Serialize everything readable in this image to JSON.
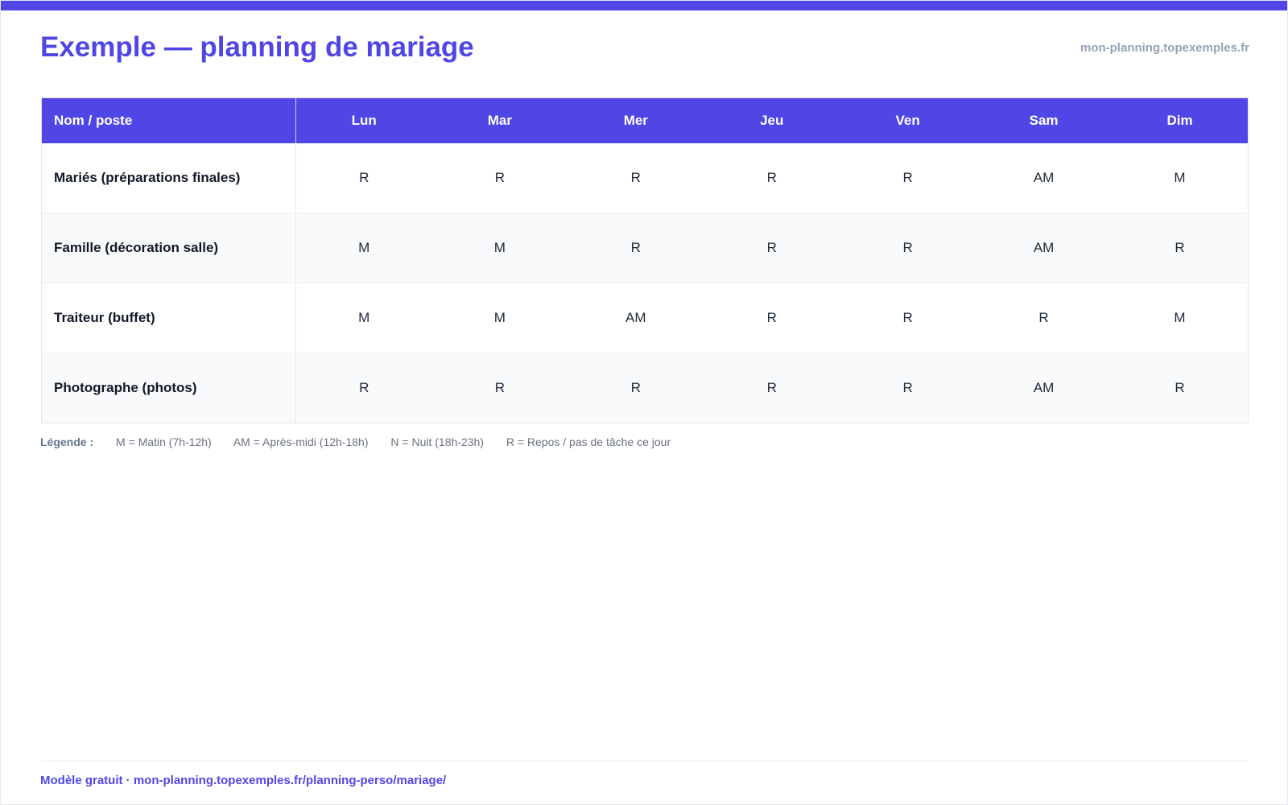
{
  "header": {
    "title": "Exemple — planning de mariage",
    "site": "mon-planning.topexemples.fr"
  },
  "table": {
    "columns": [
      "Nom / poste",
      "Lun",
      "Mar",
      "Mer",
      "Jeu",
      "Ven",
      "Sam",
      "Dim"
    ],
    "rows": [
      {
        "name": "Mariés (préparations finales)",
        "cells": [
          "R",
          "R",
          "R",
          "R",
          "R",
          "AM",
          "M"
        ]
      },
      {
        "name": "Famille (décoration salle)",
        "cells": [
          "M",
          "M",
          "R",
          "R",
          "R",
          "AM",
          "R"
        ]
      },
      {
        "name": "Traiteur (buffet)",
        "cells": [
          "M",
          "M",
          "AM",
          "R",
          "R",
          "R",
          "M"
        ]
      },
      {
        "name": "Photographe (photos)",
        "cells": [
          "R",
          "R",
          "R",
          "R",
          "R",
          "AM",
          "R"
        ]
      }
    ]
  },
  "legend": {
    "label": "Légende :",
    "items": [
      "M = Matin (7h-12h)",
      "AM = Après-midi (12h-18h)",
      "N = Nuit (18h-23h)",
      "R = Repos / pas de tâche ce jour"
    ]
  },
  "footer": {
    "text": "Modèle gratuit · mon-planning.topexemples.fr/planning-perso/mariage/"
  },
  "colors": {
    "accent": "#4f46e5",
    "muted": "#94a3b8",
    "row_alt": "#f8fafc"
  }
}
